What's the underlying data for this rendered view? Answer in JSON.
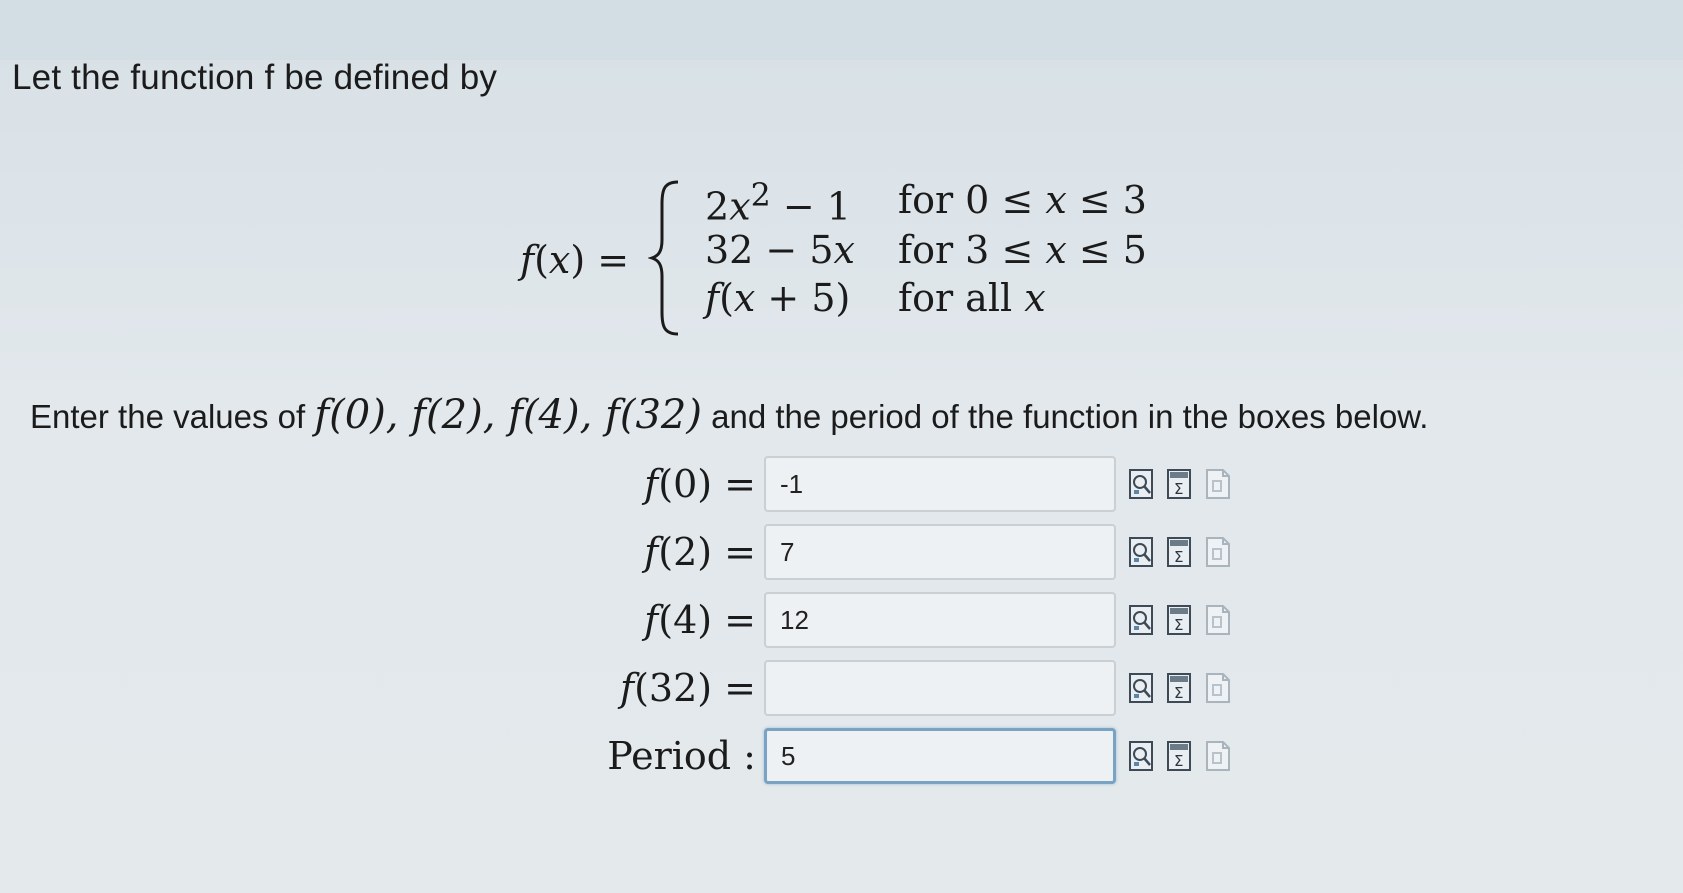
{
  "intro": "Let the function f be defined by",
  "function_def": {
    "label": "f(x) =",
    "cases": [
      {
        "expr_html": "2<span class=\"it\">x</span><sup>2</sup> − 1",
        "cond_html": "for 0 ≤ <span class=\"it\">x</span> ≤ 3"
      },
      {
        "expr_html": "32 − 5<span class=\"it\">x</span>",
        "cond_html": "for 3 ≤ <span class=\"it\">x</span> ≤ 5"
      },
      {
        "expr_html": "<span class=\"it\">f</span>(<span class=\"it\">x</span> + 5)",
        "cond_html": "for all <span class=\"it\">x</span>"
      }
    ]
  },
  "instruction": {
    "prefix": "Enter the values of",
    "math": "f(0), f(2), f(4), f(32)",
    "suffix": "and the period of the function in the boxes below."
  },
  "answers": [
    {
      "label_html": "<span class=\"it\">f</span>(0) =",
      "value": "-1",
      "active": false
    },
    {
      "label_html": "<span class=\"it\">f</span>(2) =",
      "value": "7",
      "active": false
    },
    {
      "label_html": "<span class=\"it\">f</span>(4) =",
      "value": "12",
      "active": false
    },
    {
      "label_html": "<span class=\"it\">f</span>(32) =",
      "value": "",
      "active": false
    },
    {
      "label_html": "Period :",
      "value": "5",
      "active": true
    }
  ],
  "row_icons": [
    "preview-icon",
    "equation-editor-icon",
    "answer-help-icon"
  ],
  "colors": {
    "background": "#e2e8ec",
    "input_border": "#c9cfd3",
    "input_active_border": "#7aa3c3"
  }
}
